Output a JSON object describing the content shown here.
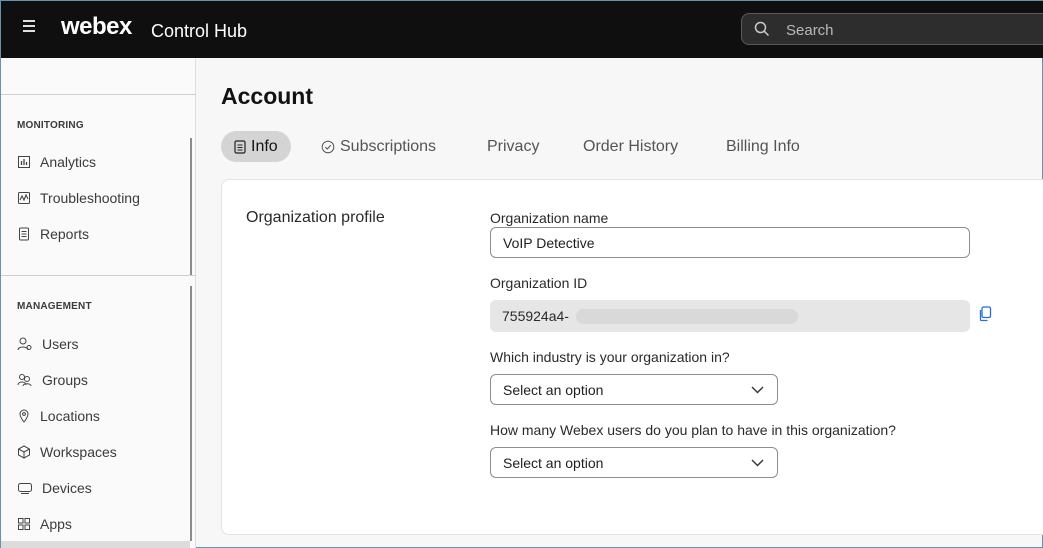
{
  "header": {
    "brand": "webex",
    "product": "Control Hub",
    "search_placeholder": "Search"
  },
  "sidebar": {
    "monitoring_title": "MONITORING",
    "monitoring_items": [
      {
        "label": "Analytics",
        "icon": "bar-chart-icon"
      },
      {
        "label": "Troubleshooting",
        "icon": "pulse-icon"
      },
      {
        "label": "Reports",
        "icon": "document-icon"
      }
    ],
    "management_title": "MANAGEMENT",
    "management_items": [
      {
        "label": "Users",
        "icon": "user-icon"
      },
      {
        "label": "Groups",
        "icon": "group-icon"
      },
      {
        "label": "Locations",
        "icon": "location-pin-icon"
      },
      {
        "label": "Workspaces",
        "icon": "workspace-icon"
      },
      {
        "label": "Devices",
        "icon": "device-icon"
      },
      {
        "label": "Apps",
        "icon": "apps-grid-icon"
      }
    ]
  },
  "main": {
    "title": "Account",
    "tabs": [
      {
        "label": "Info",
        "active": true
      },
      {
        "label": "Subscriptions",
        "active": false
      },
      {
        "label": "Privacy",
        "active": false
      },
      {
        "label": "Order History",
        "active": false
      },
      {
        "label": "Billing Info",
        "active": false
      }
    ],
    "profile": {
      "section_label": "Organization profile",
      "org_name_label": "Organization name",
      "org_name_value": "VoIP Detective",
      "org_id_label": "Organization ID",
      "org_id_value": "755924a4-",
      "industry_label": "Which industry is your organization in?",
      "industry_value": "Select an option",
      "users_label": "How many Webex users do you plan to have in this organization?",
      "users_value": "Select an option"
    }
  }
}
